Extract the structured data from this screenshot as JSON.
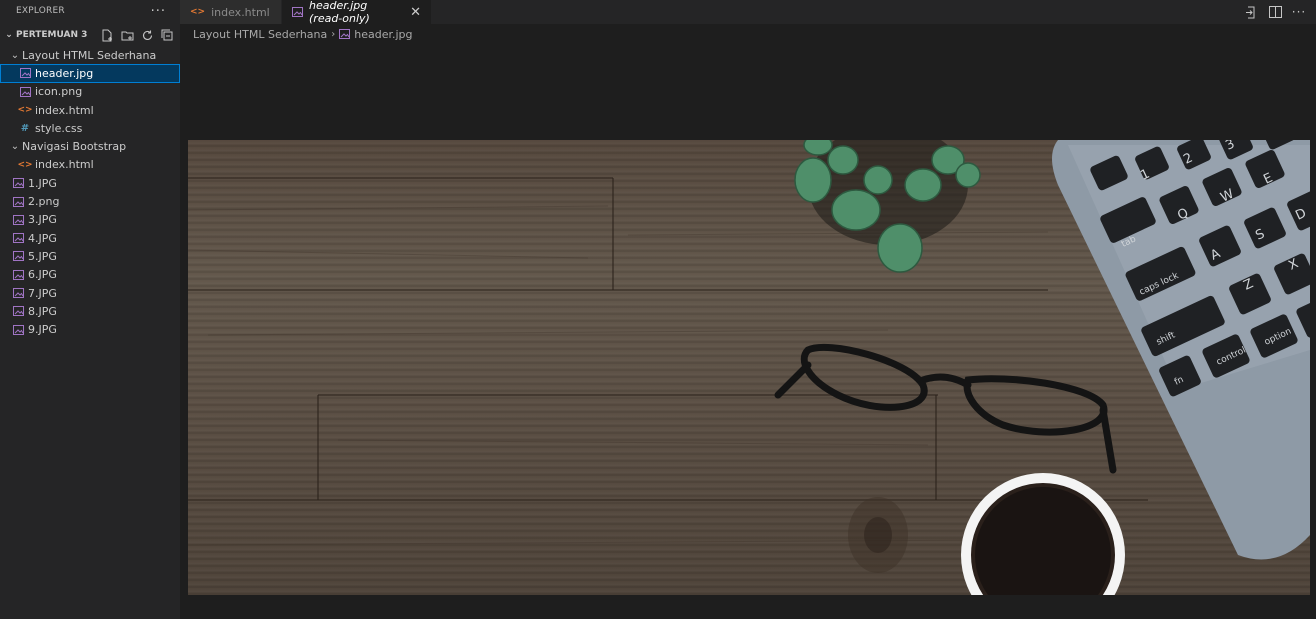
{
  "explorer": {
    "title": "EXPLORER",
    "more": "···",
    "section": "PERTEMUAN 3",
    "tree": {
      "folder1": "Layout HTML Sederhana",
      "folder1_files": [
        "header.jpg",
        "icon.png",
        "index.html",
        "style.css"
      ],
      "folder2": "Navigasi Bootstrap",
      "folder2_files": [
        "index.html"
      ],
      "root_files": [
        "1.JPG",
        "2.png",
        "3.JPG",
        "4.JPG",
        "5.JPG",
        "6.JPG",
        "7.JPG",
        "8.JPG",
        "9.JPG"
      ]
    }
  },
  "tabs": [
    {
      "label": "index.html"
    },
    {
      "label": "header.jpg (read-only)"
    }
  ],
  "breadcrumb": [
    "Layout HTML Sederhana",
    "header.jpg"
  ],
  "image": {
    "subject": "wooden desk with plant, glasses, coffee cup and laptop keyboard",
    "keys": [
      "tab",
      "caps lock",
      "shift",
      "fn",
      "control",
      "option",
      "Q",
      "W",
      "E",
      "A",
      "S",
      "D",
      "Z",
      "X",
      "1",
      "2",
      "3"
    ]
  },
  "colors": {
    "accent": "#007fd4",
    "selection": "#04395e",
    "image_icon": "#a074c4",
    "html_icon": "#e37933",
    "css_icon": "#519aba"
  }
}
